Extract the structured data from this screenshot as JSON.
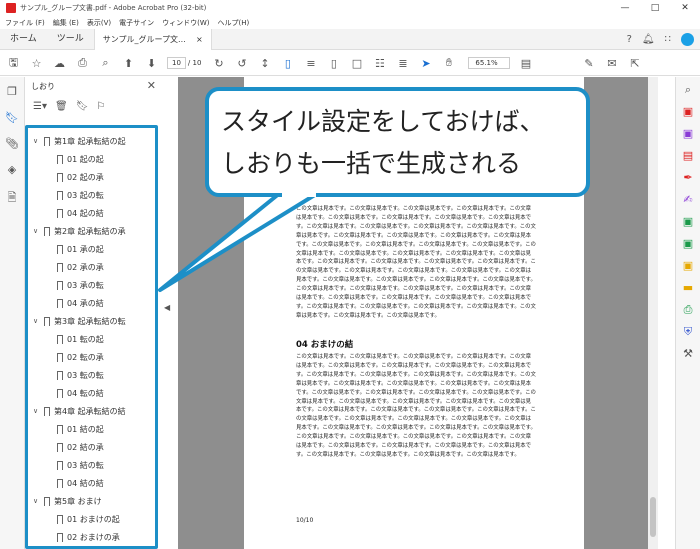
{
  "window": {
    "title": "サンプル_グループ文書.pdf - Adobe Acrobat Pro (32-bit)",
    "controls": [
      "—",
      "□",
      "✕"
    ]
  },
  "menu": [
    "ファイル (F)",
    "編集 (E)",
    "表示(V)",
    "電子サイン",
    "ウィンドウ(W)",
    "ヘルプ(H)"
  ],
  "tabs": {
    "home": "ホーム",
    "tools": "ツール",
    "document": "サンプル_グループ文...",
    "document_close": "×"
  },
  "toolbar": {
    "page_current": "10",
    "page_total": "/ 10",
    "zoom": "65.1%"
  },
  "panel": {
    "title": "しおり",
    "close": "✕"
  },
  "bookmarks": [
    {
      "type": "chap",
      "label": "第1章 起承転結の起"
    },
    {
      "type": "sub",
      "label": "01 起の起"
    },
    {
      "type": "sub",
      "label": "02 起の承"
    },
    {
      "type": "sub",
      "label": "03 起の転"
    },
    {
      "type": "sub",
      "label": "04 起の結"
    },
    {
      "type": "chap",
      "label": "第2章 起承転結の承"
    },
    {
      "type": "sub",
      "label": "01 承の起"
    },
    {
      "type": "sub",
      "label": "02 承の承"
    },
    {
      "type": "sub",
      "label": "03 承の転"
    },
    {
      "type": "sub",
      "label": "04 承の結"
    },
    {
      "type": "chap",
      "label": "第3章 起承転結の転"
    },
    {
      "type": "sub",
      "label": "01 転の起"
    },
    {
      "type": "sub",
      "label": "02 転の承"
    },
    {
      "type": "sub",
      "label": "03 転の転"
    },
    {
      "type": "sub",
      "label": "04 転の結"
    },
    {
      "type": "chap",
      "label": "第4章 起承転結の結"
    },
    {
      "type": "sub",
      "label": "01 結の起"
    },
    {
      "type": "sub",
      "label": "02 結の承"
    },
    {
      "type": "sub",
      "label": "03 結の転"
    },
    {
      "type": "sub",
      "label": "04 結の結"
    },
    {
      "type": "chap",
      "label": "第5章 おまけ"
    },
    {
      "type": "sub",
      "label": "01 おまけの起"
    },
    {
      "type": "sub",
      "label": "02 おまけの承"
    }
  ],
  "document": {
    "body_text": "この文章は見本です。この文章は見本です。この文章は見本です。この文章は見本です。この文章は見本です。この文章は見本です。この文章は見本です。この文章は見本です。この文章は見本です。この文章は見本です。この文章は見本です。この文章は見本です。この文章は見本です。この文章は見本です。この文章は見本です。この文章は見本です。この文章は見本です。この文章は見本です。この文章は見本です。この文章は見本です。この文章は見本です。この文章は見本です。この文章は見本です。この文章は見本です。この文章は見本です。この文章は見本です。この文章は見本です。この文章は見本です。この文章は見本です。この文章は見本です。この文章は見本です。この文章は見本です。この文章は見本です。この文章は見本です。この文章は見本です。この文章は見本です。この文章は見本です。この文章は見本です。この文章は見本です。この文章は見本です。この文章は見本です。この文章は見本です。この文章は見本です。この文章は見本です。この文章は見本です。この文章は見本です。この文章は見本です。この文章は見本です。この文章は見本です。この文章は見本です。この文章は見本です。この文章は見本です。この文章は見本です。この文章は見本です。この文章は見本です。この文章は見本です。",
    "heading": "04 おまけの結",
    "body_text2": "この文章は見本です。この文章は見本です。この文章は見本です。この文章は見本です。この文章は見本です。この文章は見本です。この文章は見本です。この文章は見本です。この文章は見本です。この文章は見本です。この文章は見本です。この文章は見本です。この文章は見本です。この文章は見本です。この文章は見本です。この文章は見本です。この文章は見本です。この文章は見本です。この文章は見本です。この文章は見本です。この文章は見本です。この文章は見本です。この文章は見本です。この文章は見本です。この文章は見本です。この文章は見本です。この文章は見本です。この文章は見本です。この文章は見本です。この文章は見本です。この文章は見本です。この文章は見本です。この文章は見本です。この文章は見本です。この文章は見本です。この文章は見本です。この文章は見本です。この文章は見本です。この文章は見本です。この文章は見本です。この文章は見本です。この文章は見本です。この文章は見本です。この文章は見本です。この文章は見本です。この文章は見本です。この文章は見本です。この文章は見本です。この文章は見本です。この文章は見本です。この文章は見本です。この文章は見本です。この文章は見本です。",
    "page_number": "10/10"
  },
  "callout": {
    "line1": "スタイル設定をしておけば、",
    "line2": "しおりも一括で生成される"
  },
  "colors": {
    "accent": "#1d8fc7",
    "acrobat_red": "#d22222",
    "toolbar_blue": "#1a6fd1"
  }
}
